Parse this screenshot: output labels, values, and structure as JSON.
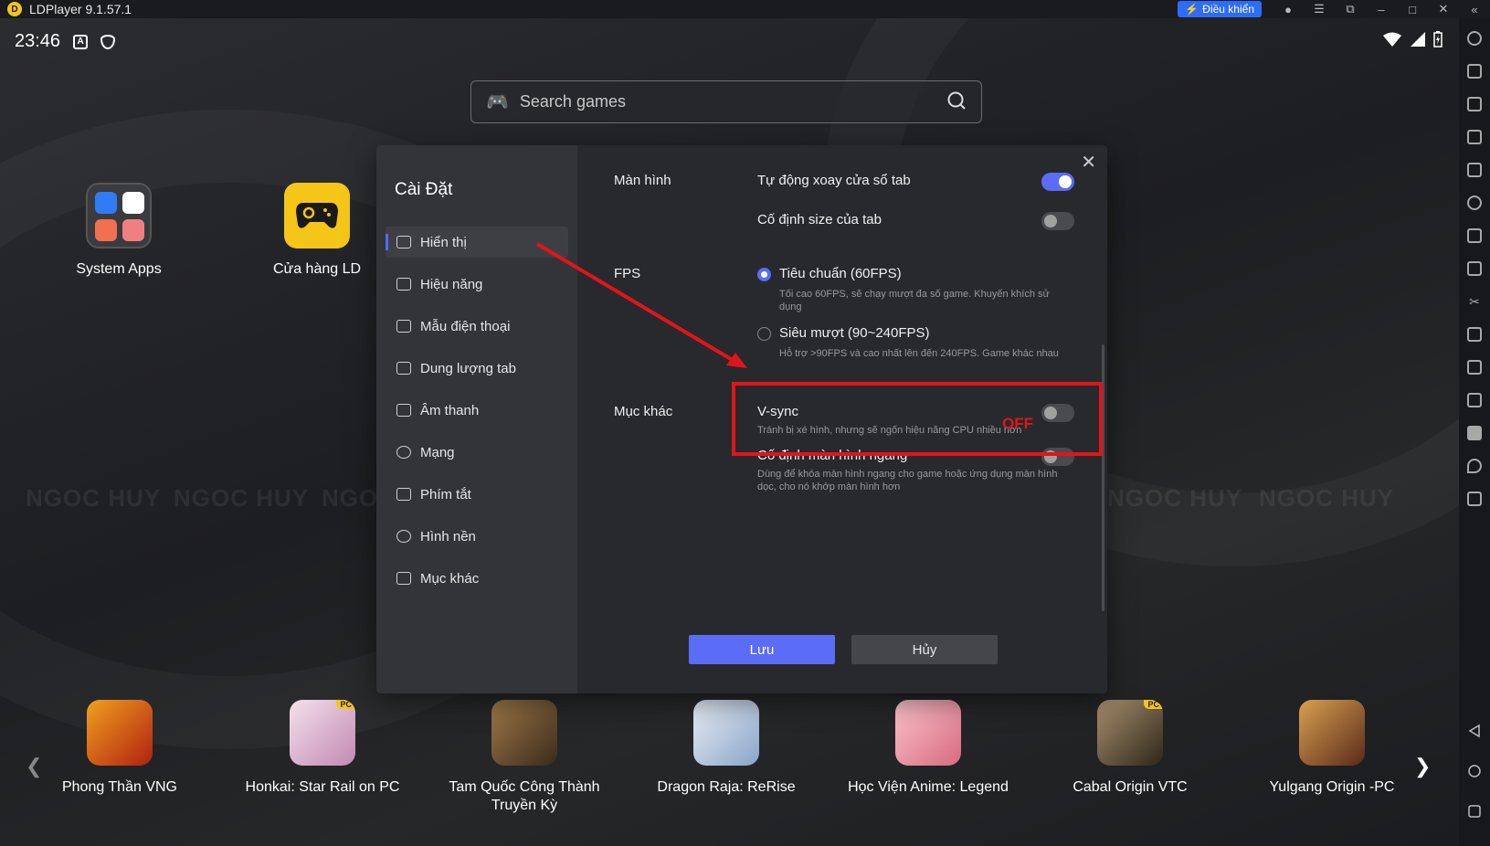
{
  "window": {
    "title": "LDPlayer 9.1.57.1",
    "control_button": "Điều khiển"
  },
  "status": {
    "time": "23:46"
  },
  "search": {
    "placeholder": "Search games"
  },
  "desktop_apps": [
    {
      "label": "System Apps"
    },
    {
      "label": "Cửa hàng LD"
    }
  ],
  "watermark": "NGOC HUY",
  "dialog": {
    "title": "Cài Đặt",
    "menu": [
      "Hiển thị",
      "Hiệu năng",
      "Mẫu điện thoại",
      "Dung lượng tab",
      "Âm thanh",
      "Mạng",
      "Phím tắt",
      "Hình nền",
      "Mục khác"
    ],
    "sections": {
      "screen": {
        "label": "Màn hình",
        "auto_rotate": {
          "label": "Tự động xoay cửa sổ tab",
          "enabled": true
        },
        "fixed_size": {
          "label": "Cố định size của tab",
          "enabled": false
        }
      },
      "fps": {
        "label": "FPS",
        "standard": {
          "label": "Tiêu chuẩn (60FPS)",
          "desc": "Tối cao 60FPS, sẽ chạy mượt đa số game. Khuyến khích sử dụng",
          "selected": true
        },
        "smooth": {
          "label": "Siêu mượt (90~240FPS)",
          "desc": "Hỗ trợ >90FPS và cao nhất lên đến 240FPS. Game khác nhau thì hiệu quả sẽ khác nhau",
          "selected": false
        }
      },
      "other": {
        "label": "Mục khác",
        "vsync": {
          "label": "V-sync",
          "desc": "Tránh bị xé hình, nhưng sẽ ngốn hiệu năng CPU nhiều hơn",
          "enabled": false
        },
        "landscape": {
          "label": "Cố định màn hình ngang",
          "desc": "Dùng để khóa màn hình ngang cho game hoặc ứng dụng màn hình dọc, cho nó khớp màn hình hơn",
          "enabled": false
        }
      }
    },
    "buttons": {
      "save": "Lưu",
      "cancel": "Hủy"
    },
    "annotation": {
      "off_text": "OFF",
      "color": "#e0151b"
    }
  },
  "games": [
    {
      "label": "Phong Thần VNG",
      "color": "#c0392b"
    },
    {
      "label": "Honkai: Star Rail on PC",
      "color": "#d8a9c9",
      "badge": "PC"
    },
    {
      "label": "Tam Quốc Công Thành Truyền Kỳ",
      "color": "#7a5a3a"
    },
    {
      "label": "Dragon Raja: ReRise",
      "color": "#b7c8de"
    },
    {
      "label": "Học Viện Anime: Legend",
      "color": "#e89aa8"
    },
    {
      "label": "Cabal Origin VTC",
      "color": "#6b5a40",
      "badge": "PC"
    },
    {
      "label": "Yulgang Origin -PC",
      "color": "#8a4a2a"
    }
  ],
  "colors": {
    "accent": "#5b6cf7",
    "brand": "#f5c518"
  }
}
